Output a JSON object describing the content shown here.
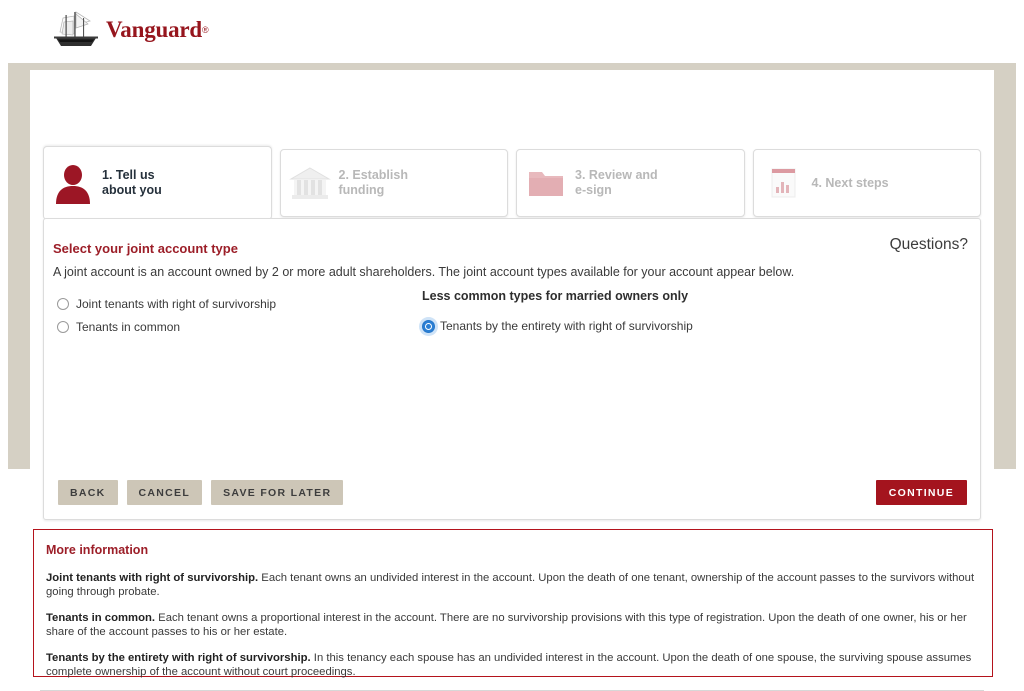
{
  "brand": {
    "name": "Vanguard",
    "registered_mark": "®",
    "logo_icon": "sailing-ship-icon",
    "color": "#96151d"
  },
  "steps": [
    {
      "label": "1. Tell us\nabout you",
      "icon": "person-icon",
      "active": true
    },
    {
      "label": "2. Establish\nfunding",
      "icon": "bank-building-icon",
      "active": false
    },
    {
      "label": "3. Review and\ne-sign",
      "icon": "folder-icon",
      "active": false
    },
    {
      "label": "4. Next steps",
      "icon": "chart-document-icon",
      "active": false
    }
  ],
  "main": {
    "section_title": "Select your joint account type",
    "questions_link": "Questions?",
    "intro": "A joint account is an account owned by 2 or more adult shareholders. The joint account types available for your account appear below.",
    "left_options": [
      {
        "label": "Joint tenants with right of survivorship",
        "checked": false
      },
      {
        "label": "Tenants in common",
        "checked": false
      }
    ],
    "right_heading": "Less common types for married owners only",
    "right_options": [
      {
        "label": "Tenants by the entirety with right of survivorship",
        "checked": true
      }
    ]
  },
  "buttons": {
    "back": "BACK",
    "cancel": "CANCEL",
    "save_for_later": "SAVE FOR LATER",
    "continue": "CONTINUE",
    "continue_color": "#a4141e",
    "secondary_color": "#cdc6b7"
  },
  "more_information": {
    "title": "More information",
    "border_color": "#b4131c",
    "paragraphs": [
      {
        "term": "Joint tenants with right of survivorship.",
        "text": " Each tenant owns an undivided interest in the account. Upon the death of one tenant, ownership of the account passes to the survivors without going through probate."
      },
      {
        "term": "Tenants in common.",
        "text": " Each tenant owns a proportional interest in the account. There are no survivorship provisions with this type of registration. Upon the death of one owner, his or her share of the account passes to his or her estate."
      },
      {
        "term": "Tenants by the entirety with right of survivorship.",
        "text": " In this tenancy each spouse has an undivided interest in the account. Upon the death of one spouse, the surviving spouse assumes complete ownership of the account without court proceedings."
      }
    ]
  }
}
